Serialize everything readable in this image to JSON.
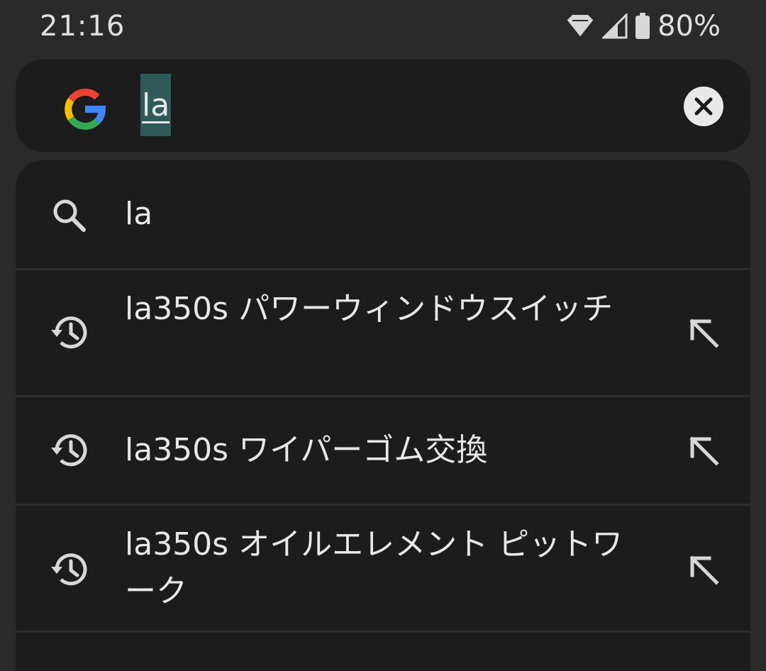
{
  "status_bar": {
    "time": "21:16",
    "battery_pct": "80%",
    "icons": [
      "wifi-icon",
      "cell-signal-icon",
      "battery-icon"
    ]
  },
  "search": {
    "query": "la",
    "logo_icon": "google-g-icon",
    "clear_icon": "clear-icon"
  },
  "suggestions": [
    {
      "type": "search",
      "icon": "search-icon",
      "label": "la"
    },
    {
      "type": "history",
      "icon": "history-icon",
      "label": "la350s パワーウィンドウスイッチ",
      "action_icon": "insert-arrow-icon"
    },
    {
      "type": "history",
      "icon": "history-icon",
      "label": "la350s ワイパーゴム交換",
      "action_icon": "insert-arrow-icon"
    },
    {
      "type": "history",
      "icon": "history-icon",
      "label": "la350s オイルエレメント ピットワーク",
      "action_icon": "insert-arrow-icon"
    }
  ],
  "colors": {
    "background": "#2a2a2a",
    "surface": "#1c1c1c",
    "selection": "#2f5a57",
    "text": "#e8e8e8"
  }
}
